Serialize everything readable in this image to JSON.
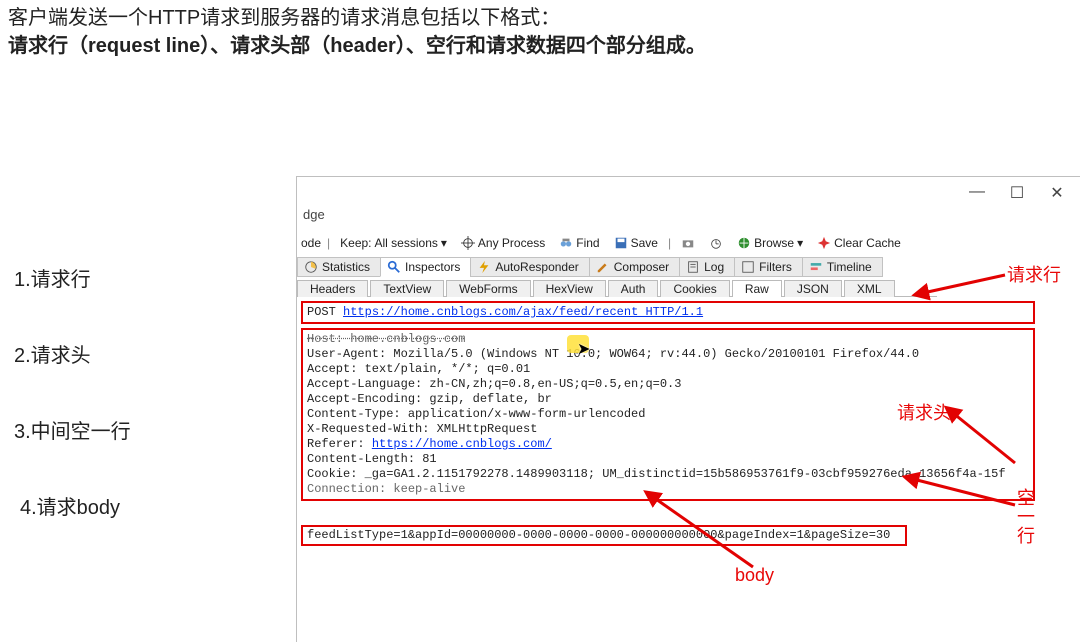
{
  "intro": {
    "line1": "客户端发送一个HTTP请求到服务器的请求消息包括以下格式：",
    "line2": "请求行（request line）、请求头部（header）、空行和请求数据四个部分组成。"
  },
  "leftList": {
    "i1": "1.请求行",
    "i2": "2.请求头",
    "i3": "3.中间空一行",
    "i4": "4.请求body"
  },
  "window": {
    "title_fragment": "dge",
    "minimize": "—",
    "maximize": "☐",
    "close": "✕"
  },
  "toolbar": {
    "ode": "ode",
    "keep_label": "Keep:",
    "keep_value": "All sessions",
    "any_process": "Any Process",
    "find": "Find",
    "save": "Save",
    "browse": "Browse",
    "clear_cache": "Clear Cache"
  },
  "tabs": {
    "statistics": "Statistics",
    "inspectors": "Inspectors",
    "autoresponder": "AutoResponder",
    "composer": "Composer",
    "log": "Log",
    "filters": "Filters",
    "timeline": "Timeline"
  },
  "subtabs": {
    "headers": "Headers",
    "textview": "TextView",
    "webforms": "WebForms",
    "hexview": "HexView",
    "auth": "Auth",
    "cookies": "Cookies",
    "raw": "Raw",
    "json": "JSON",
    "xml": "XML"
  },
  "request_line": {
    "method": "POST",
    "url": "https://home.cnblogs.com/ajax/feed/recent HTTP/1.1"
  },
  "headers": {
    "l1": "Host: home.cnblogs.com",
    "l2": "User-Agent: Mozilla/5.0 (Windows NT 10.0; WOW64; rv:44.0) Gecko/20100101 Firefox/44.0",
    "l3a": "Accept: text/plain, */*; q=0.01",
    "l4": "Accept-Language: zh-CN,zh;q=0.8,en-US;q=0.5,en;q=0.3",
    "l5": "Accept-Encoding: gzip, deflate, br",
    "l6": "Content-Type: application/x-www-form-urlencoded",
    "l7": "X-Requested-With: XMLHttpRequest",
    "l8_label": "Referer: ",
    "l8_url": "https://home.cnblogs.com/",
    "l9": "Content-Length: 81",
    "l10": "Cookie: _ga=GA1.2.1151792278.1489903118; UM_distinctid=15b586953761f9-03cbf959276eda-13656f4a-15f",
    "l11": "Connection: keep-alive"
  },
  "body": {
    "text": "feedListType=1&appId=00000000-0000-0000-0000-000000000000&pageIndex=1&pageSize=30"
  },
  "annotations": {
    "reqline": "请求行",
    "reqhead": "请求头",
    "blank": "空一行",
    "body": "body"
  }
}
